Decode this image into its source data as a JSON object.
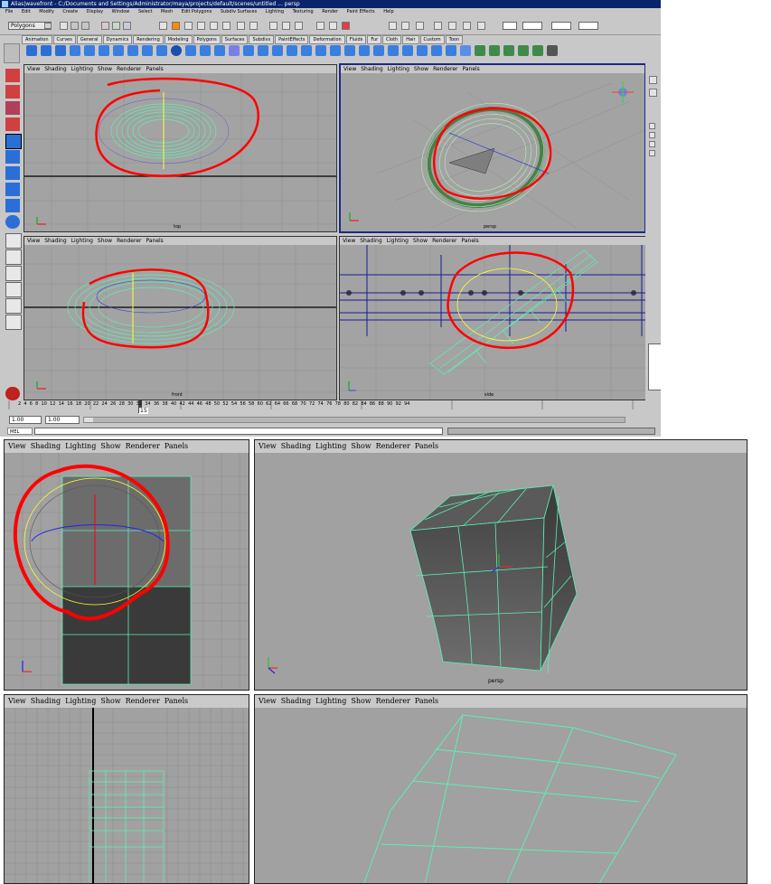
{
  "window": {
    "title": "Alias|wavefront - C:/Documents and Settings/Administrator/maya/projects/default/scenes/untitled ... persp",
    "menus": [
      "File",
      "Edit",
      "Modify",
      "Create",
      "Display",
      "Window",
      "Select",
      "Mesh",
      "Edit Polygons",
      "Subdiv Surfaces",
      "Lighting",
      "Texturing",
      "Render",
      "Paint Effects",
      "Help"
    ],
    "mode_dropdown": "Polygons",
    "shelf_tabs": [
      "Animation",
      "Curves",
      "General",
      "Dynamics",
      "Rendering",
      "Modeling",
      "Polygons",
      "Surfaces",
      "Subdivs",
      "PaintEffects",
      "Deformation",
      "Fluids",
      "Fur",
      "Cloth",
      "Hair",
      "Custom",
      "Toon"
    ]
  },
  "panel_menu": {
    "view": "View",
    "shading": "Shading",
    "lighting": "Lighting",
    "show": "Show",
    "renderer": "Renderer",
    "panels": "Panels"
  },
  "top_viewports": {
    "top": "top",
    "persp": "persp",
    "front": "front",
    "side": "side"
  },
  "bottom_viewports": {
    "persp_label": "persp"
  },
  "timeline": {
    "ticks": [
      "2",
      "4",
      "6",
      "8",
      "10",
      "12",
      "14",
      "16",
      "18",
      "20",
      "22",
      "24",
      "26",
      "28",
      "30",
      "32",
      "34",
      "36",
      "38",
      "40",
      "42",
      "44",
      "46",
      "48",
      "50",
      "52",
      "54",
      "56",
      "58",
      "60",
      "62",
      "64",
      "66",
      "68",
      "70",
      "72",
      "74",
      "76",
      "78",
      "80",
      "82",
      "84",
      "86",
      "88",
      "90",
      "92",
      "94"
    ],
    "current_frame": "15",
    "range_start": "1.00",
    "range_end": "1.00",
    "cmd_label": "MEL"
  },
  "colors": {
    "viewport_bg": "#a3a3a3",
    "wire": "#5cf0b0",
    "selection": "#ff0000",
    "active_border": "#1a2a88"
  }
}
